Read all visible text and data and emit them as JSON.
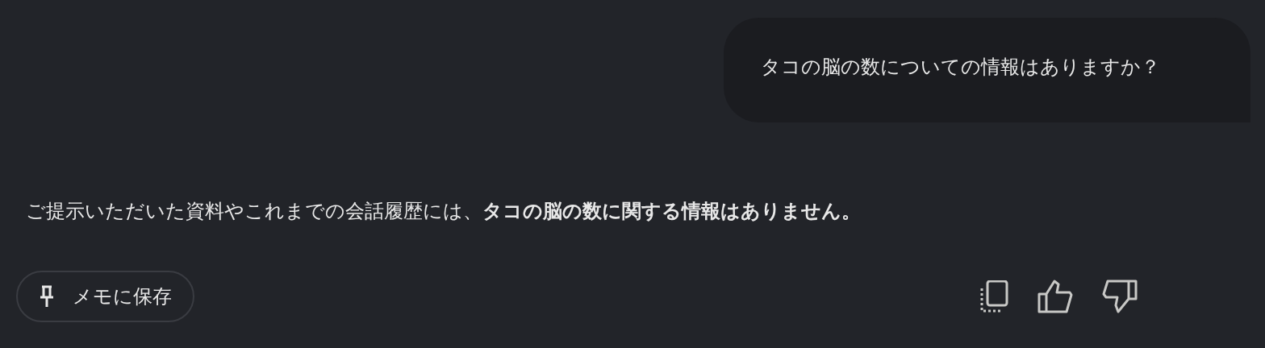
{
  "user_message": {
    "text": "タコの脳の数についての情報はありますか？"
  },
  "response": {
    "text": "ご提示いただいた資料やこれまでの会話履歴には、**タコの脳の数に関する情報はありません。**"
  },
  "actions": {
    "save_button": "メモに保存"
  }
}
